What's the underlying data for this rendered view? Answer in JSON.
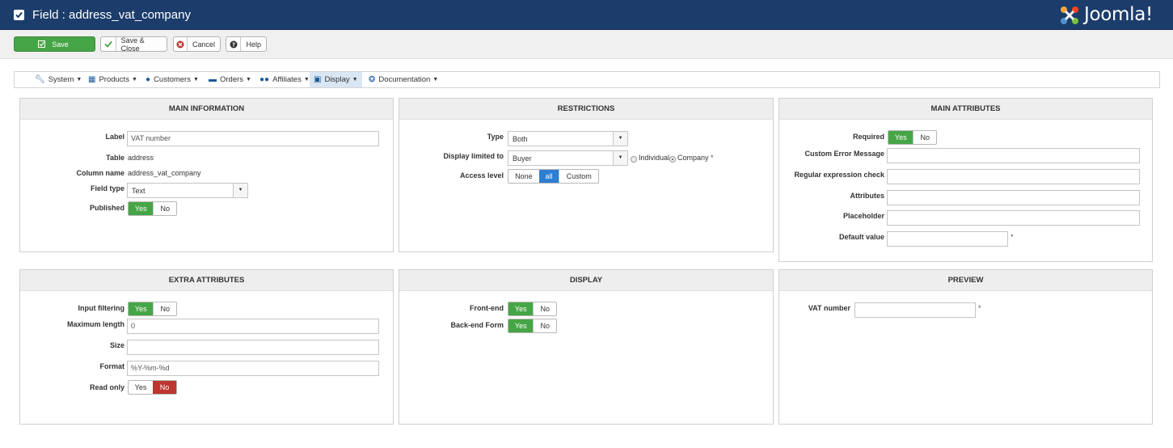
{
  "header": {
    "title": "Field : address_vat_company",
    "brand": "Joomla!"
  },
  "toolbar": {
    "save_label": "Save",
    "save_close_label": "Save & Close",
    "cancel_label": "Cancel",
    "help_label": "Help"
  },
  "menu": {
    "items": [
      {
        "label": "System",
        "icon": "wrench-icon"
      },
      {
        "label": "Products",
        "icon": "cubes-icon"
      },
      {
        "label": "Customers",
        "icon": "user-icon"
      },
      {
        "label": "Orders",
        "icon": "credit-card-icon"
      },
      {
        "label": "Affiliates",
        "icon": "users-icon"
      },
      {
        "label": "Display",
        "icon": "monitor-icon"
      },
      {
        "label": "Documentation",
        "icon": "lifebuoy-icon"
      }
    ],
    "active": "Display"
  },
  "main_information": {
    "heading": "MAIN INFORMATION",
    "label_label": "Label",
    "label_value": "VAT number",
    "table_label": "Table",
    "table_value": "address",
    "column_label": "Column name",
    "column_value": "address_vat_company",
    "field_type_label": "Field type",
    "field_type_value": "Text",
    "published_label": "Published",
    "yes": "Yes",
    "no": "No"
  },
  "restrictions": {
    "heading": "RESTRICTIONS",
    "type_label": "Type",
    "type_value": "Both",
    "display_limited_label": "Display limited to",
    "display_limited_value": "Buyer",
    "radio_individual": "Individual",
    "radio_company": "Company",
    "star": "*",
    "access_label": "Access level",
    "access_none": "None",
    "access_all": "all",
    "access_custom": "Custom"
  },
  "main_attributes": {
    "heading": "MAIN ATTRIBUTES",
    "required_label": "Required",
    "custom_error_label": "Custom Error Message",
    "regex_label": "Regular expression check",
    "attributes_label": "Attributes",
    "placeholder_label": "Placeholder",
    "default_value_label": "Default value",
    "star": "*",
    "yes": "Yes",
    "no": "No"
  },
  "extra_attributes": {
    "heading": "EXTRA ATTRIBUTES",
    "input_filtering_label": "Input filtering",
    "max_length_label": "Maximum length",
    "max_length_value": "0",
    "size_label": "Size",
    "format_label": "Format",
    "format_value": "%Y-%m-%d",
    "read_only_label": "Read only",
    "yes": "Yes",
    "no": "No"
  },
  "display": {
    "heading": "DISPLAY",
    "front_end_label": "Front-end",
    "back_end_label": "Back-end Form",
    "yes": "Yes",
    "no": "No"
  },
  "preview": {
    "heading": "PREVIEW",
    "vat_label": "VAT number",
    "star": "*"
  },
  "colors": {
    "header_bg": "#1c3d6b",
    "save_green": "#46a546",
    "yes_green": "#46a546",
    "no_red": "#bd362f",
    "all_blue": "#2a7fd4"
  }
}
